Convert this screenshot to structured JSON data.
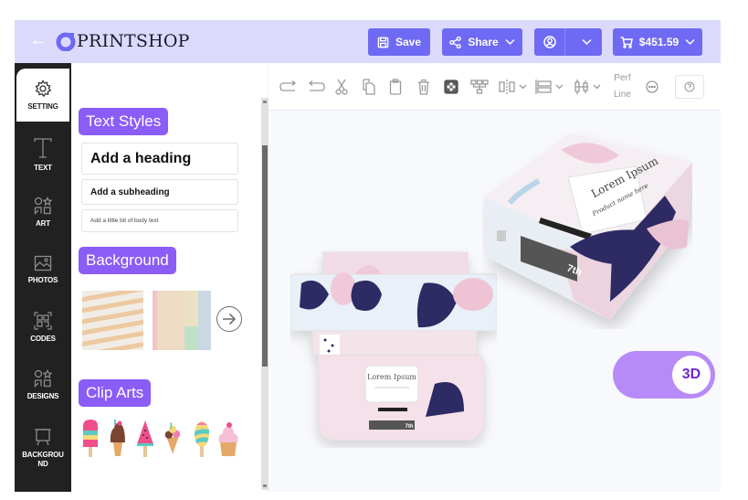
{
  "header": {
    "back_icon": "arrow-left-icon",
    "brand": "PRINTSHOP",
    "save_label": "Save",
    "share_label": "Share",
    "cart_total": "$451.59"
  },
  "rail": {
    "items": [
      {
        "label": "SETTING",
        "icon": "gear-icon"
      },
      {
        "label": "TEXT",
        "icon": "text-icon"
      },
      {
        "label": "ART",
        "icon": "shapes-icon"
      },
      {
        "label": "PHOTOS",
        "icon": "image-icon"
      },
      {
        "label": "CODES",
        "icon": "qr-code-icon"
      },
      {
        "label": "DESIGNS",
        "icon": "shapes-icon"
      },
      {
        "label": "BACKGROU ND",
        "icon": "easel-icon"
      }
    ]
  },
  "panel": {
    "text_styles_title": "Text Styles",
    "heading": "Add a heading",
    "subheading": "Add a subheading",
    "body": "Add a little bit of body text",
    "background_title": "Background",
    "clip_arts_title": "Clip Arts",
    "clip_arts": [
      "popsicle",
      "chocolate ice cream cone",
      "watermelon popsicle",
      "triple scoop cone",
      "striped popsicle",
      "cupcake"
    ]
  },
  "toolbar": {
    "perf_line_top": "Perf",
    "perf_line_bottom": "Line"
  },
  "canvas": {
    "box_title": "Lorem Ipsum",
    "box_subtitle": "Product name here",
    "box_badge": "7th",
    "toggle_label": "3D"
  },
  "colors": {
    "header_bg": "#dcdafc",
    "button_bg": "#6f6af3",
    "tag_bg": "#8b5cf6",
    "toggle_bg": "#b88af8",
    "toggle_text": "#6d28d9",
    "rail_bg": "#212121"
  }
}
